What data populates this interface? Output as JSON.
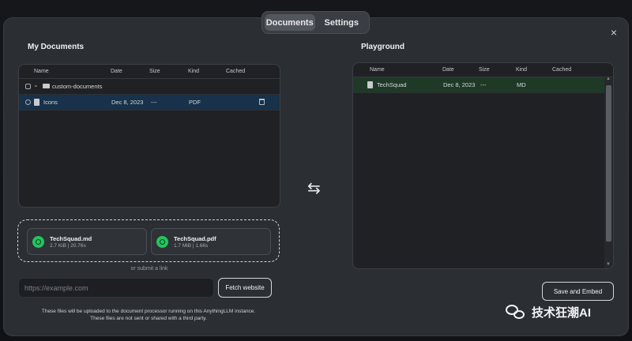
{
  "tabs": [
    {
      "label": "Documents",
      "active": true
    },
    {
      "label": "Settings",
      "active": false
    }
  ],
  "my_documents": {
    "title": "My Documents",
    "columns": [
      "Name",
      "Date",
      "Size",
      "Kind",
      "Cached"
    ],
    "rows": [
      {
        "type": "folder",
        "name": "custom-documents",
        "date": "",
        "size": "",
        "kind": ""
      },
      {
        "type": "file",
        "name": "Icons",
        "date": "Dec 8, 2023",
        "size": "---",
        "kind": "PDF",
        "selected": true
      }
    ]
  },
  "playground": {
    "title": "Playground",
    "columns": [
      "Name",
      "Date",
      "Size",
      "Kind",
      "Cached"
    ],
    "rows": [
      {
        "type": "file",
        "name": "TechSquad",
        "date": "Dec 8, 2023",
        "size": "---",
        "kind": "MD"
      }
    ]
  },
  "uploads": [
    {
      "name": "TechSquad.md",
      "meta": "2.7 KiB | 20.76s"
    },
    {
      "name": "TechSquad.pdf",
      "meta": "1.7 MiB | 1.66s"
    }
  ],
  "or_link_text": "or submit a link",
  "url_input": {
    "placeholder": "https://example.com",
    "value": ""
  },
  "fetch_label": "Fetch website",
  "notice_line1": "These files will be uploaded to the document processor running on this AnythingLLM instance.",
  "notice_line2": "These files are not sent or shared with a third party.",
  "save_label": "Save and Embed",
  "close_glyph": "×",
  "swap_glyph": "⇆",
  "watermark_text": "技术狂潮AI",
  "colors": {
    "selected_row": "#17324a",
    "playground_row": "#1e3a26",
    "success": "#22c55e"
  }
}
